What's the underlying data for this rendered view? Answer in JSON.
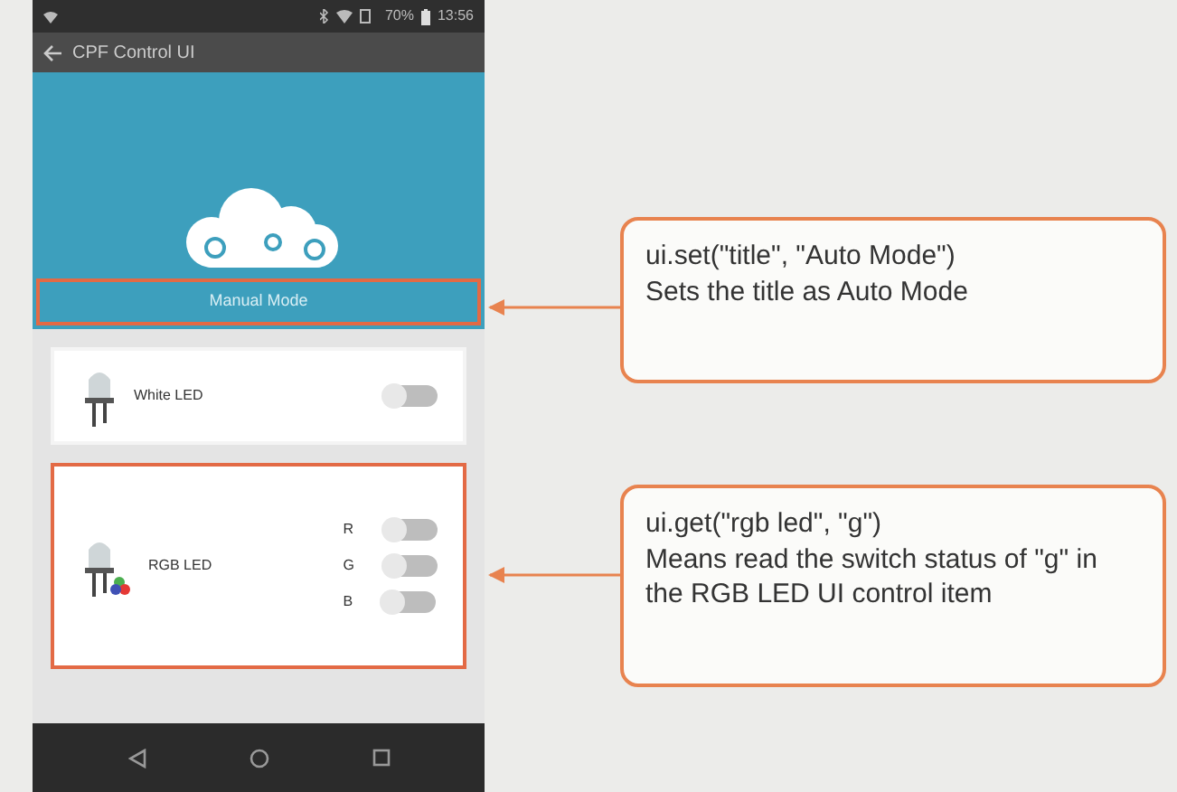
{
  "status_bar": {
    "battery": "70%",
    "time": "13:56"
  },
  "app_bar": {
    "title": "CPF Control UI"
  },
  "header": {
    "title": "Manual Mode",
    "highlighted": true
  },
  "controls": [
    {
      "kind": "single",
      "label": "White LED",
      "highlighted": false,
      "switches": [
        {
          "on": false
        }
      ]
    },
    {
      "kind": "rgb",
      "label": "RGB LED",
      "highlighted": true,
      "switches": [
        {
          "label": "R",
          "on": false
        },
        {
          "label": "G",
          "on": false
        },
        {
          "label": "B",
          "on": false
        }
      ]
    }
  ],
  "callouts": [
    {
      "code": "ui.set(\"title\", \"Auto Mode\")",
      "text": "Sets the title as Auto Mode"
    },
    {
      "code": "ui.get(\"rgb led\", \"g\")",
      "text": "Means read the switch status of \"g\" in the RGB LED UI control item"
    }
  ]
}
